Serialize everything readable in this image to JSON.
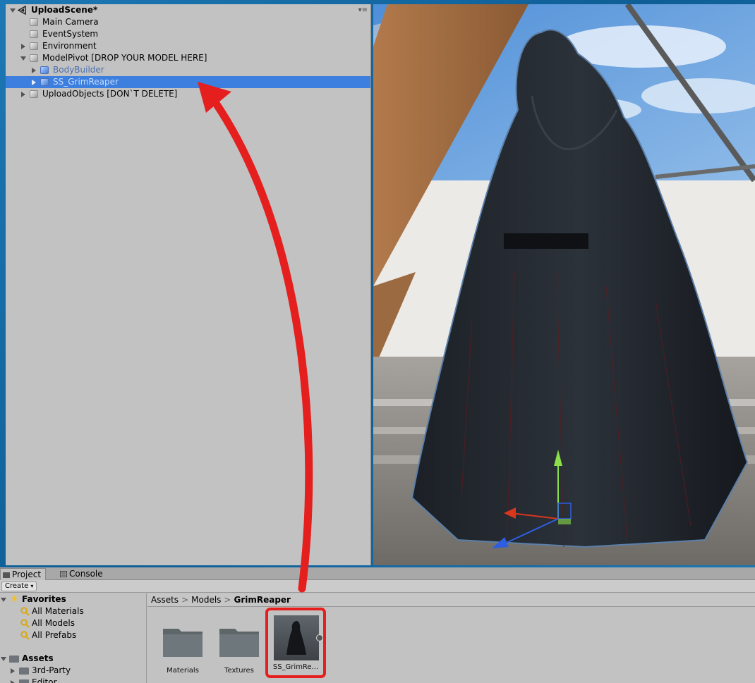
{
  "hierarchy": {
    "scene_name": "UploadScene*",
    "items": [
      {
        "label": "Main Camera"
      },
      {
        "label": "EventSystem"
      },
      {
        "label": "Environment"
      },
      {
        "label": "ModelPivot [DROP YOUR MODEL HERE]"
      },
      {
        "label": "BodyBuilder"
      },
      {
        "label": "SS_GrimReaper"
      },
      {
        "label": "UploadObjects [DON`T DELETE]"
      }
    ]
  },
  "project": {
    "tabs": {
      "project": "Project",
      "console": "Console"
    },
    "create_label": "Create",
    "favorites": {
      "label": "Favorites",
      "items": [
        "All Materials",
        "All Models",
        "All Prefabs"
      ]
    },
    "assets_tree": {
      "label": "Assets",
      "items": [
        "3rd-Party",
        "Editor"
      ]
    },
    "breadcrumb": [
      "Assets",
      "Models",
      "GrimReaper"
    ],
    "files": [
      {
        "name": "Materials"
      },
      {
        "name": "Textures"
      },
      {
        "name": "SS_GrimRe..."
      }
    ]
  },
  "colors": {
    "selection": "#3c7fde",
    "annotation": "#e51e1e",
    "panel": "#c2c2c2"
  }
}
